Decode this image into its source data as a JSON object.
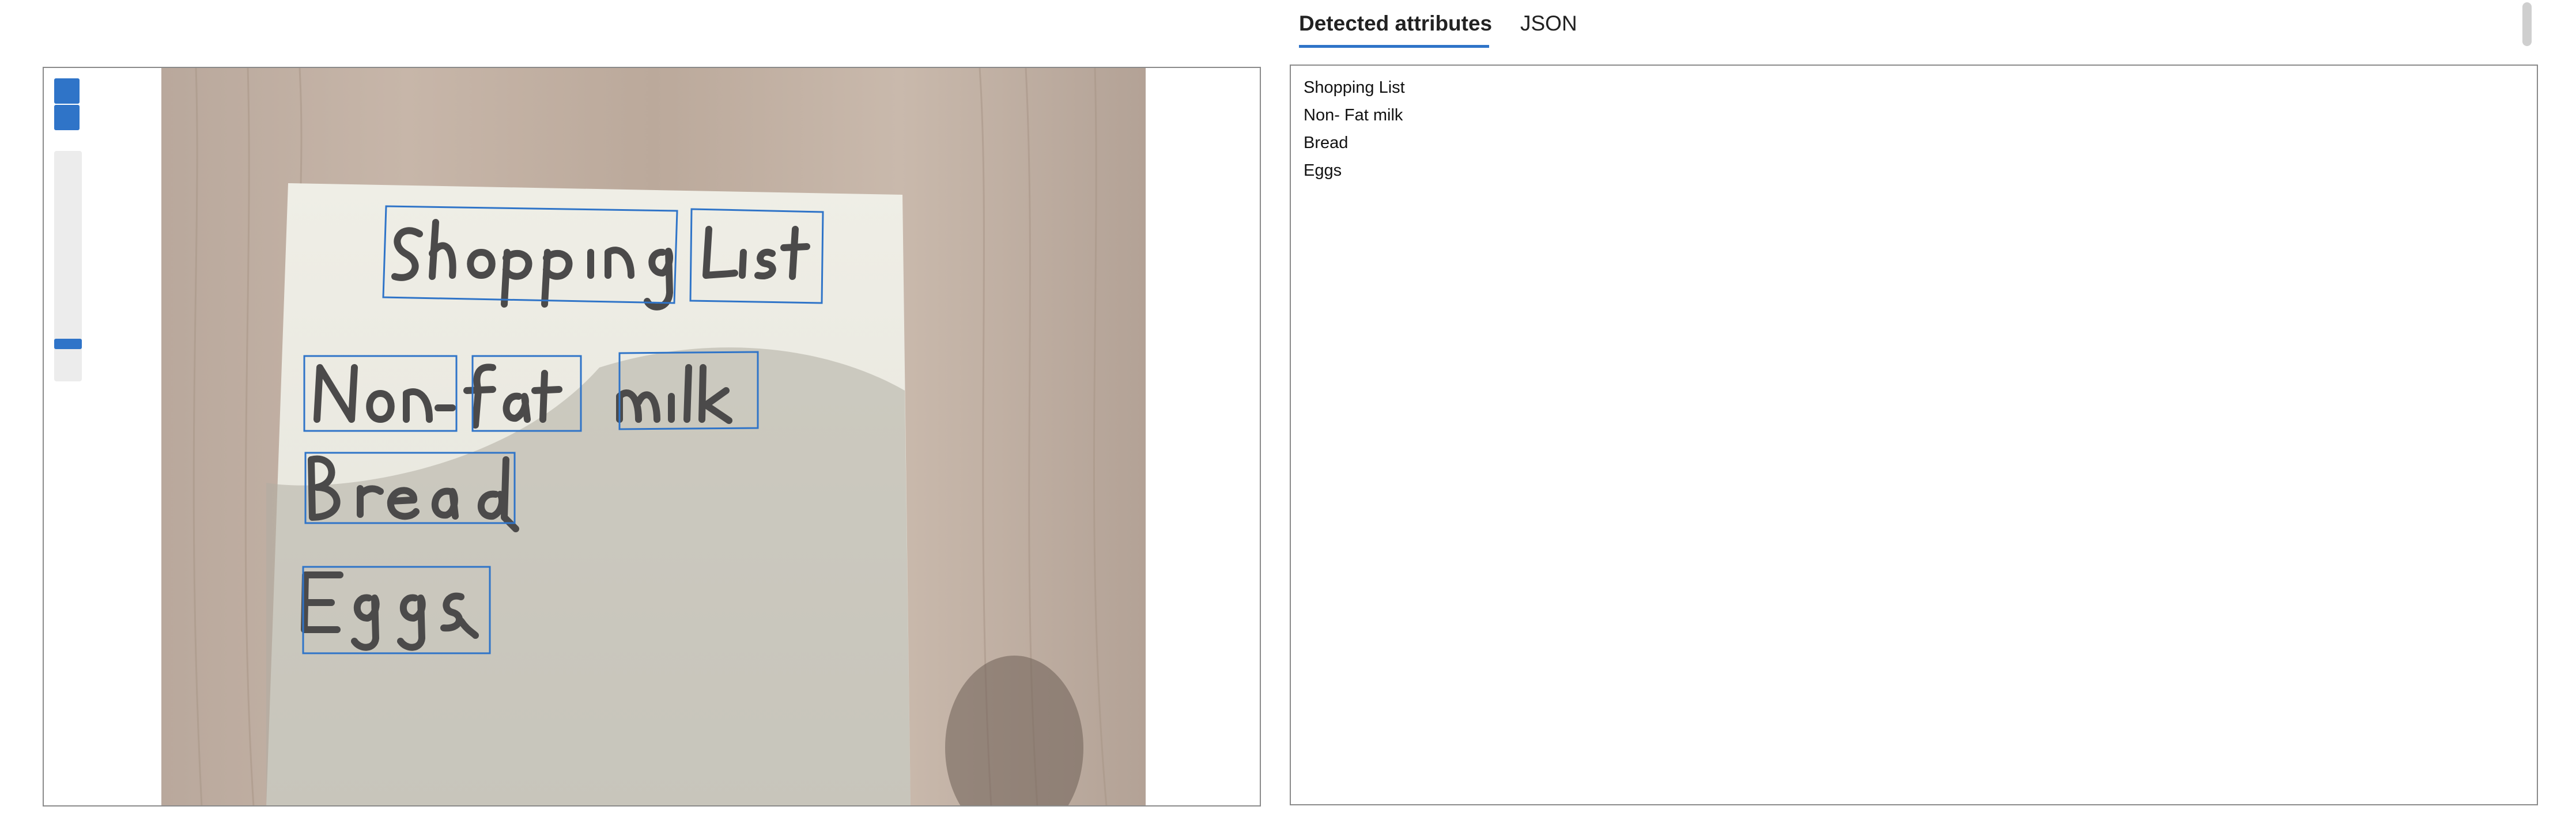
{
  "tabs": [
    {
      "label": "Detected attributes",
      "active": true
    },
    {
      "label": "JSON",
      "active": false
    }
  ],
  "detected_lines": [
    "Shopping List",
    "Non- Fat milk",
    "Bread",
    "Eggs"
  ],
  "image_handwriting": [
    "Shopping",
    "List",
    "Non-",
    "Fat",
    "milk",
    "Bread",
    "Eggs"
  ],
  "image_viewer": {
    "zoom_level": 0.1
  },
  "colors": {
    "accent": "#2f74c8",
    "border": "#8a8a8a"
  }
}
